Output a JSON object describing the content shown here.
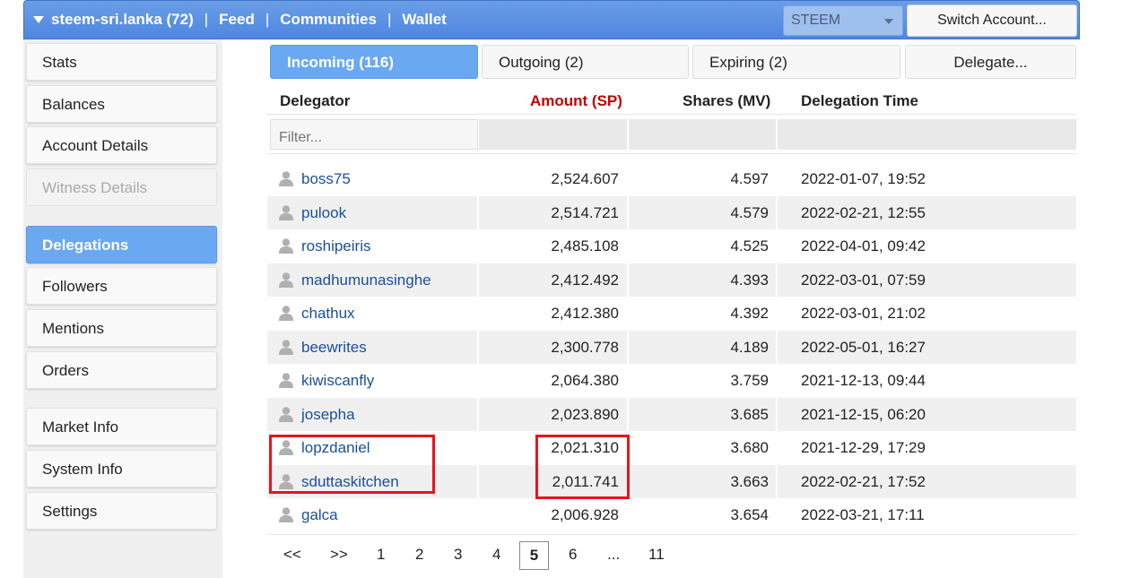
{
  "header": {
    "account": "steem-sri.lanka (72)",
    "nav": [
      "Feed",
      "Communities",
      "Wallet"
    ],
    "separator": "|",
    "token_select": "STEEM",
    "switch_account": "Switch Account..."
  },
  "sidebar": {
    "items": [
      {
        "label": "Stats",
        "state": "normal"
      },
      {
        "label": "Balances",
        "state": "normal"
      },
      {
        "label": "Account Details",
        "state": "normal"
      },
      {
        "label": "Witness Details",
        "state": "disabled"
      },
      {
        "label": "Delegations",
        "state": "active"
      },
      {
        "label": "Followers",
        "state": "normal"
      },
      {
        "label": "Mentions",
        "state": "normal"
      },
      {
        "label": "Orders",
        "state": "normal"
      },
      {
        "label": "Market Info",
        "state": "normal"
      },
      {
        "label": "System Info",
        "state": "normal"
      },
      {
        "label": "Settings",
        "state": "normal"
      }
    ]
  },
  "tabs": {
    "incoming": "Incoming (116)",
    "outgoing": "Outgoing (2)",
    "expiring": "Expiring (2)",
    "delegate": "Delegate..."
  },
  "table": {
    "columns": {
      "delegator": "Delegator",
      "amount": "Amount (SP)",
      "shares": "Shares (MV)",
      "time": "Delegation Time"
    },
    "filter_placeholder": "Filter...",
    "rows": [
      {
        "user": "boss75",
        "amount": "2,524.607",
        "shares": "4.597",
        "time": "2022-01-07, 19:52"
      },
      {
        "user": "pulook",
        "amount": "2,514.721",
        "shares": "4.579",
        "time": "2022-02-21, 12:55"
      },
      {
        "user": "roshipeiris",
        "amount": "2,485.108",
        "shares": "4.525",
        "time": "2022-04-01, 09:42"
      },
      {
        "user": "madhumunasinghe",
        "amount": "2,412.492",
        "shares": "4.393",
        "time": "2022-03-01, 07:59"
      },
      {
        "user": "chathux",
        "amount": "2,412.380",
        "shares": "4.392",
        "time": "2022-03-01, 21:02"
      },
      {
        "user": "beewrites",
        "amount": "2,300.778",
        "shares": "4.189",
        "time": "2022-05-01, 16:27"
      },
      {
        "user": "kiwiscanfly",
        "amount": "2,064.380",
        "shares": "3.759",
        "time": "2021-12-13, 09:44"
      },
      {
        "user": "josepha",
        "amount": "2,023.890",
        "shares": "3.685",
        "time": "2021-12-15, 06:20"
      },
      {
        "user": "lopzdaniel",
        "amount": "2,021.310",
        "shares": "3.680",
        "time": "2021-12-29, 17:29"
      },
      {
        "user": "sduttaskitchen",
        "amount": "2,011.741",
        "shares": "3.663",
        "time": "2022-02-21, 17:52"
      },
      {
        "user": "galca",
        "amount": "2,006.928",
        "shares": "3.654",
        "time": "2022-03-21, 17:11"
      }
    ]
  },
  "pager": {
    "prev": "<<",
    "next": ">>",
    "pages": [
      "1",
      "2",
      "3",
      "4",
      "5",
      "6",
      "...",
      "11"
    ],
    "current": "5"
  },
  "colors": {
    "header_blue": "#4f86e0",
    "active_blue": "#6aa8f2",
    "link_blue": "#1a4f9c",
    "amount_header_red": "#c00000",
    "highlight_red": "#e8141c"
  },
  "icons": {
    "menu": "triangle-down-icon",
    "select_caret": "chevron-down-icon",
    "user": "user-silhouette-icon"
  }
}
